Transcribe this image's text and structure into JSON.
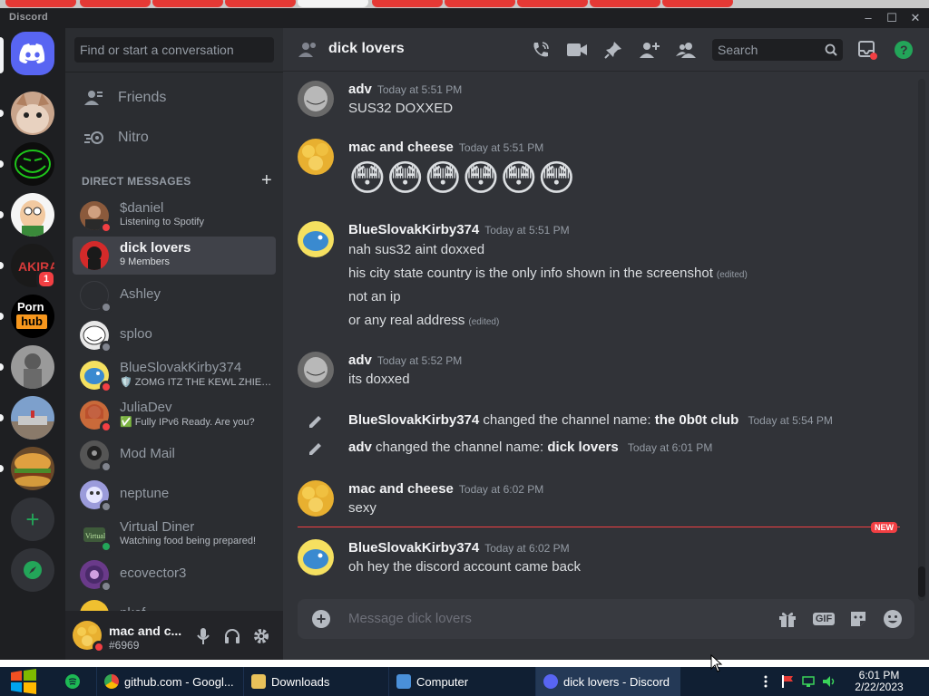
{
  "app": {
    "title": "Discord"
  },
  "window_controls": {
    "minimize": "–",
    "maximize": "☐",
    "close": "✕"
  },
  "servers": [
    {
      "name": "home",
      "icon": "discord-logo-icon",
      "color": "#5865f2"
    },
    {
      "name": "cat",
      "color": "#c9a58c"
    },
    {
      "name": "trollface",
      "color": "#1ec51a"
    },
    {
      "name": "family-guy",
      "color": "#f5f5f5"
    },
    {
      "name": "akira",
      "color": "#1a1a1a",
      "mentions": "1"
    },
    {
      "name": "ph",
      "label_top": "Porn",
      "label_box": "hub",
      "color": "#000000"
    },
    {
      "name": "sculpture",
      "color": "#8a8a8a"
    },
    {
      "name": "palace",
      "color": "#6a8ab0"
    },
    {
      "name": "burger",
      "color": "#d49a3c"
    }
  ],
  "rail_actions": {
    "add": "+",
    "explore": "explore-icon"
  },
  "dm_sidebar": {
    "search_placeholder": "Find or start a conversation",
    "nav": [
      {
        "label": "Friends",
        "icon": "friends-icon"
      },
      {
        "label": "Nitro",
        "icon": "nitro-icon"
      }
    ],
    "header": "DIRECT MESSAGES",
    "header_plus": "+",
    "items": [
      {
        "name": "$daniel",
        "sub": "Listening to Spotify",
        "status": "dnd",
        "color": "#8b5a3c"
      },
      {
        "name": "dick lovers",
        "sub": "9 Members",
        "status": "",
        "color": "#d42a2a",
        "selected": true
      },
      {
        "name": "Ashley",
        "sub": "",
        "status": "off",
        "color": "#2b2d31"
      },
      {
        "name": "sploo",
        "sub": "",
        "status": "off",
        "color": "#e8e8e8"
      },
      {
        "name": "BlueSlovakKirby374",
        "sub": "🛡️ ZOMG ITZ THE KEWL ZHIE…",
        "status": "dnd",
        "color": "#5fb4e6"
      },
      {
        "name": "JuliaDev",
        "sub": "✅ Fully IPv6 Ready. Are you?",
        "status": "dnd",
        "color": "#c96a3a"
      },
      {
        "name": "Mod Mail",
        "sub": "",
        "status": "off",
        "color": "#555555"
      },
      {
        "name": "neptune",
        "sub": "",
        "status": "off",
        "color": "#9b9bdb"
      },
      {
        "name": "Virtual Diner",
        "sub": "Watching food being prepared!",
        "status": "on",
        "color": "#3e5a3a"
      },
      {
        "name": "ecovector3",
        "sub": "",
        "status": "off",
        "color": "#6a3a8a"
      },
      {
        "name": "nkef",
        "sub": "",
        "status": "",
        "color": "#f0c030"
      }
    ]
  },
  "user_panel": {
    "name": "mac and c...",
    "tag": "#6969",
    "mic": "mic-icon",
    "headset": "headset-icon",
    "settings": "gear-icon"
  },
  "chat": {
    "channel": "dick lovers",
    "search_placeholder": "Search",
    "messages": [
      {
        "author": "adv",
        "time": "Today at 5:51 PM",
        "lines": [
          {
            "text": "SUS32 DOXXED",
            "edited": ""
          }
        ]
      },
      {
        "author": "mac and cheese",
        "time": "Today at 5:51 PM",
        "emoji": [
          "😳",
          "😳",
          "😳",
          "😳",
          "😳",
          "😳"
        ]
      },
      {
        "author": "BlueSlovakKirby374",
        "time": "Today at 5:51 PM",
        "lines": [
          {
            "text": "nah sus32 aint doxxed",
            "edited": ""
          },
          {
            "text": "his city state country is the only info shown in the screenshot",
            "edited": "(edited)"
          },
          {
            "text": "not an ip",
            "edited": ""
          },
          {
            "text": "or any real address",
            "edited": "(edited)"
          }
        ]
      },
      {
        "author": "adv",
        "time": "Today at 5:52 PM",
        "lines": [
          {
            "text": "its doxxed",
            "edited": ""
          }
        ]
      },
      {
        "author": "mac and cheese",
        "time": "Today at 6:02 PM",
        "lines": [
          {
            "text": "sexy",
            "edited": ""
          }
        ]
      },
      {
        "author": "BlueSlovakKirby374",
        "time": "Today at 6:02 PM",
        "lines": [
          {
            "text": "oh hey the discord account came back",
            "edited": ""
          }
        ]
      }
    ],
    "system": [
      {
        "actor": "BlueSlovakKirby374",
        "action": "changed the channel name:",
        "value": "the 0b0t club",
        "time": "Today at 5:54 PM"
      },
      {
        "actor": "adv",
        "action": "changed the channel name:",
        "value": "dick lovers",
        "time": "Today at 6:01 PM"
      }
    ],
    "new_marker": "NEW",
    "composer_placeholder": "Message dick lovers",
    "composer_gif": "GIF"
  },
  "taskbar": {
    "apps": [
      {
        "label": "github.com - Googl...",
        "color": "#e8453c"
      },
      {
        "label": "Downloads",
        "color": "#e8c15a"
      },
      {
        "label": "Computer",
        "color": "#4a90d9"
      },
      {
        "label": "dick lovers - Discord",
        "color": "#5865f2"
      }
    ],
    "time": "6:01 PM",
    "date": "2/22/2023"
  }
}
